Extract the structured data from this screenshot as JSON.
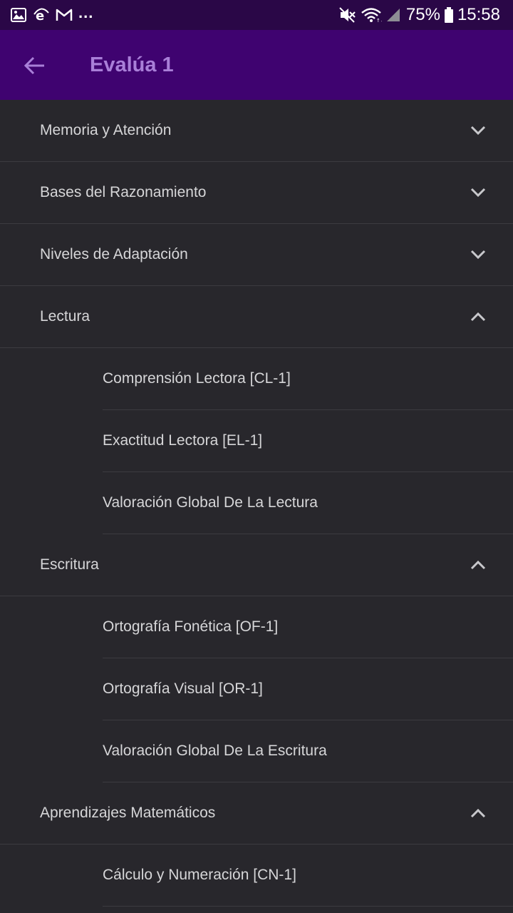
{
  "status_bar": {
    "icons_left": [
      "gallery-icon",
      "ie-icon",
      "gmail-icon"
    ],
    "overflow": "...",
    "icons_right": [
      "mute-icon",
      "wifi-icon",
      "signal-icon"
    ],
    "battery_percent": "75%",
    "battery_icon": "battery-icon",
    "time": "15:58"
  },
  "app_bar": {
    "back_icon": "arrow-left-icon",
    "title": "Evalúa 1"
  },
  "colors": {
    "status_bar_bg": "#2a0747",
    "app_bar_bg": "#3f0370",
    "title": "#a97fd8",
    "list_bg": "#28272c",
    "text": "#d6d6d8",
    "divider": "#3c3b40"
  },
  "list": {
    "sections": [
      {
        "label": "Memoria y Atención",
        "expanded": false,
        "items": []
      },
      {
        "label": "Bases del Razonamiento",
        "expanded": false,
        "items": []
      },
      {
        "label": "Niveles de Adaptación",
        "expanded": false,
        "items": []
      },
      {
        "label": "Lectura",
        "expanded": true,
        "items": [
          {
            "label": "Comprensión Lectora [CL-1]"
          },
          {
            "label": "Exactitud Lectora [EL-1]"
          },
          {
            "label": "Valoración Global De La Lectura"
          }
        ]
      },
      {
        "label": "Escritura",
        "expanded": true,
        "items": [
          {
            "label": "Ortografía Fonética [OF-1]"
          },
          {
            "label": "Ortografía Visual [OR-1]"
          },
          {
            "label": "Valoración Global De La Escritura"
          }
        ]
      },
      {
        "label": "Aprendizajes Matemáticos",
        "expanded": true,
        "items": [
          {
            "label": "Cálculo y Numeración [CN-1]"
          }
        ]
      }
    ]
  }
}
